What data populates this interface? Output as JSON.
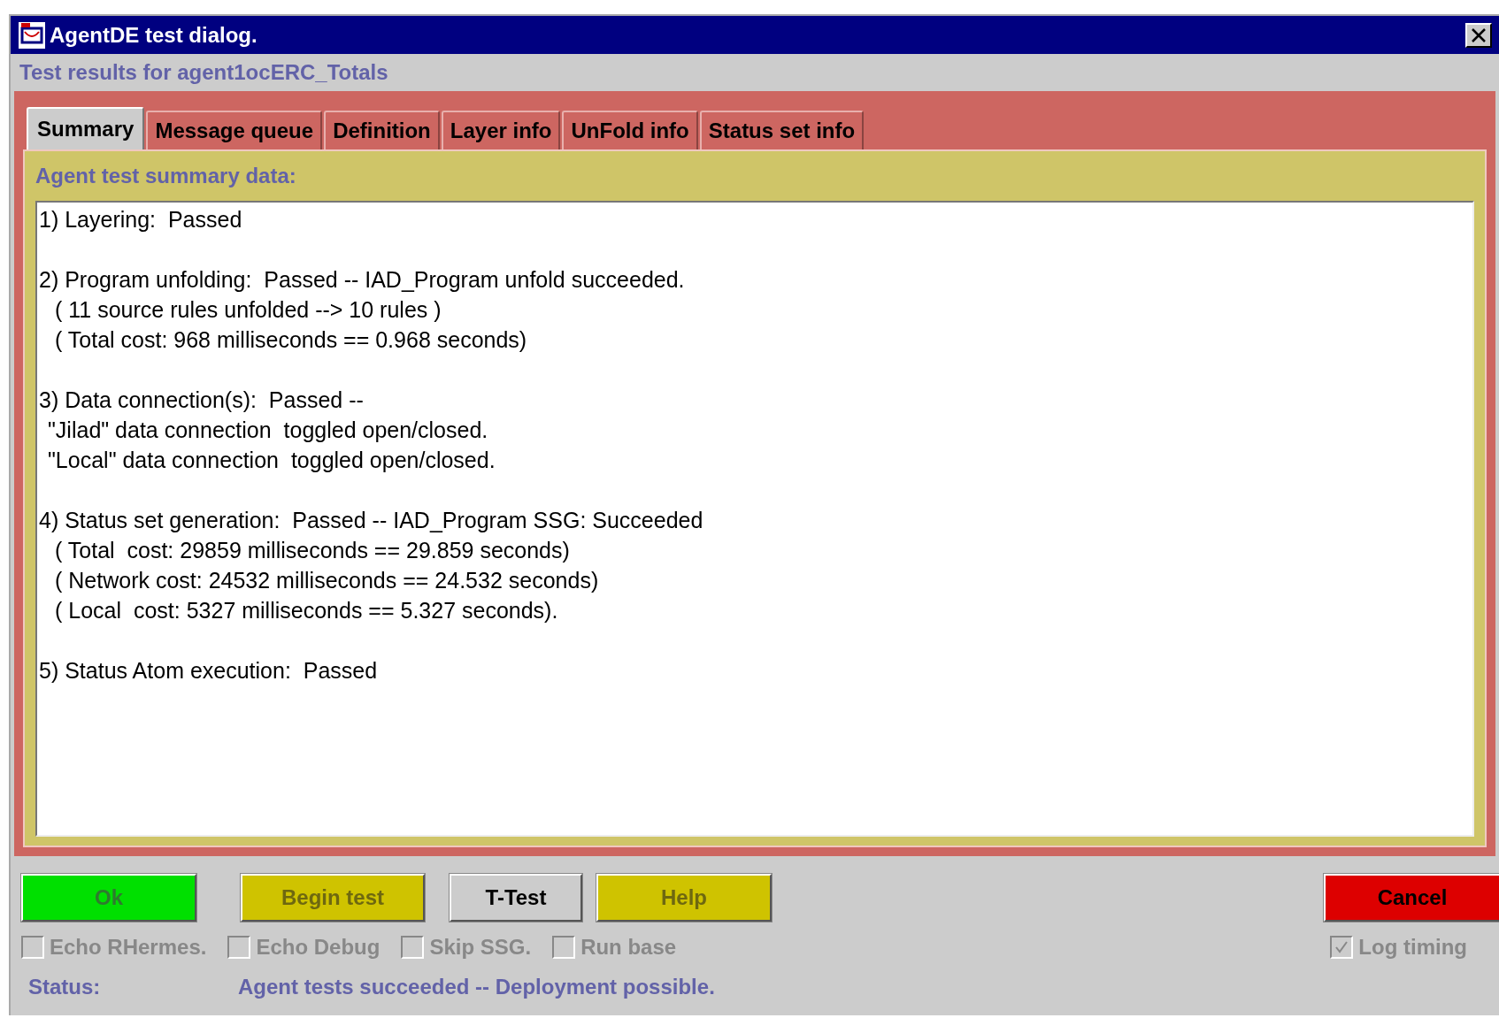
{
  "window": {
    "title": "AgentDE test dialog."
  },
  "subtitle": "Test results for agent1ocERC_Totals",
  "tabs": [
    {
      "label": "Summary",
      "selected": true
    },
    {
      "label": "Message queue",
      "selected": false
    },
    {
      "label": "Definition",
      "selected": false
    },
    {
      "label": "Layer info",
      "selected": false
    },
    {
      "label": "UnFold info",
      "selected": false
    },
    {
      "label": "Status set info",
      "selected": false
    }
  ],
  "panel": {
    "title": "Agent test summary data:",
    "paragraphs": [
      [
        {
          "kind": "head",
          "text": "1) Layering:  Passed"
        }
      ],
      [
        {
          "kind": "head",
          "text": "2) Program unfolding:  Passed -- IAD_Program unfold succeeded."
        },
        {
          "kind": "detail",
          "text": "( 11 source rules unfolded --> 10 rules )"
        },
        {
          "kind": "detail",
          "text": "( Total cost: 968 milliseconds == 0.968 seconds)"
        }
      ],
      [
        {
          "kind": "head",
          "text": "3) Data connection(s):  Passed --"
        },
        {
          "kind": "quote",
          "text": "\"Jilad\" data connection  toggled open/closed."
        },
        {
          "kind": "quote",
          "text": "\"Local\" data connection  toggled open/closed."
        }
      ],
      [
        {
          "kind": "head",
          "text": "4) Status set generation:  Passed -- IAD_Program SSG: Succeeded"
        },
        {
          "kind": "detail",
          "text": "( Total  cost: 29859 milliseconds == 29.859 seconds)"
        },
        {
          "kind": "detail",
          "text": "( Network cost: 24532 milliseconds == 24.532 seconds)"
        },
        {
          "kind": "detail",
          "text": "( Local  cost: 5327 milliseconds == 5.327 seconds)."
        }
      ],
      [
        {
          "kind": "head",
          "text": "5) Status Atom execution:  Passed"
        }
      ]
    ]
  },
  "buttons": [
    {
      "label": "Ok",
      "kind": "ok",
      "disabled": true
    },
    {
      "label": "Begin test",
      "kind": "begin",
      "disabled": true
    },
    {
      "label": "T-Test",
      "kind": "plain",
      "disabled": false
    },
    {
      "label": "Help",
      "kind": "help",
      "disabled": true
    },
    {
      "label": "Cancel",
      "kind": "cancel",
      "disabled": false
    }
  ],
  "checkboxes": [
    {
      "label": "Echo RHermes.",
      "checked": false,
      "disabled": true
    },
    {
      "label": "Echo Debug",
      "checked": false,
      "disabled": true
    },
    {
      "label": "Skip SSG.",
      "checked": false,
      "disabled": true
    },
    {
      "label": "Run base",
      "checked": false,
      "disabled": true
    },
    {
      "label": "Log timing",
      "checked": true,
      "disabled": true
    }
  ],
  "status_bar": {
    "label": "Status:",
    "message": "Agent tests succeeded -- Deployment possible."
  }
}
